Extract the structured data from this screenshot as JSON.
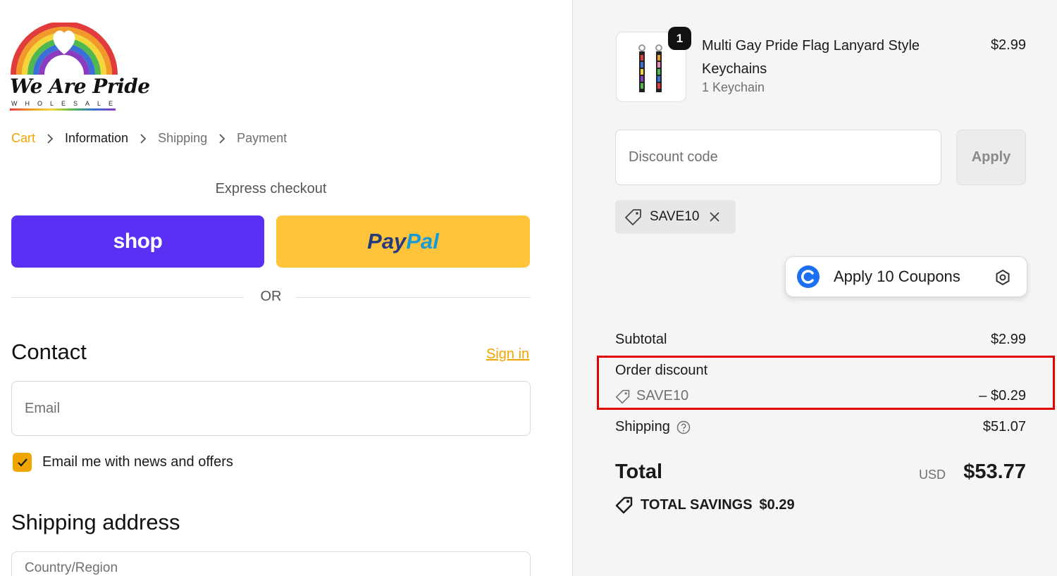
{
  "brand": {
    "name": "We Are Pride",
    "tagline": "WHOLESALE",
    "colors": [
      "#e23b3b",
      "#f19a2b",
      "#f4d63a",
      "#4fb84f",
      "#3a6fd8",
      "#8b3bbf"
    ]
  },
  "breadcrumb": {
    "items": [
      {
        "label": "Cart",
        "state": "link"
      },
      {
        "label": "Information",
        "state": "current"
      },
      {
        "label": "Shipping",
        "state": "upcoming"
      },
      {
        "label": "Payment",
        "state": "upcoming"
      }
    ]
  },
  "express_checkout": {
    "label": "Express checkout",
    "shop_label": "shop",
    "paypal_label_a": "Pay",
    "paypal_label_b": "Pal",
    "shop_color": "#5a31f4",
    "paypal_color": "#ffc439",
    "or_label": "OR"
  },
  "contact": {
    "heading": "Contact",
    "sign_in_label": "Sign in",
    "email_placeholder": "Email",
    "newsletter_label": "Email me with news and offers",
    "newsletter_checked": true
  },
  "shipping_address": {
    "heading": "Shipping address",
    "country_placeholder": "Country/Region"
  },
  "accent_color": "#f0a500",
  "order": {
    "item": {
      "name": "Multi Gay Pride Flag Lanyard Style Keychains",
      "variant": "1 Keychain",
      "price": "$2.99",
      "quantity": "1"
    },
    "discount_placeholder": "Discount code",
    "apply_label": "Apply",
    "applied_code": "SAVE10",
    "coupons_button_label": "Apply 10 Coupons",
    "subtotal_label": "Subtotal",
    "subtotal_value": "$2.99",
    "order_discount_label": "Order discount",
    "order_discount_code": "SAVE10",
    "order_discount_value": "– $0.29",
    "shipping_label": "Shipping",
    "shipping_value": "$51.07",
    "total_label": "Total",
    "total_currency": "USD",
    "total_value": "$53.77",
    "savings_label": "TOTAL SAVINGS",
    "savings_value": "$0.29",
    "highlight_color": "#e00000"
  }
}
